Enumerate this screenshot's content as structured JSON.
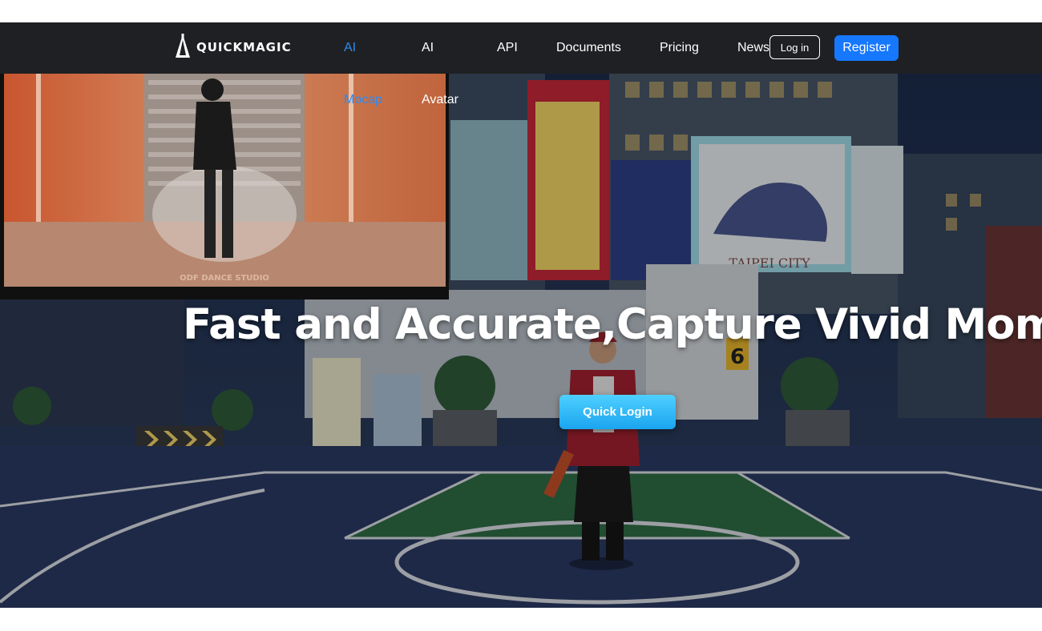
{
  "logo": {
    "text": "QUICKMAGIC",
    "icon": "quickmagic-logo-icon"
  },
  "nav": {
    "items": [
      {
        "label": "AI",
        "active": true
      },
      {
        "label": "AI",
        "active": false
      },
      {
        "label": "API",
        "active": false
      },
      {
        "label": "Documents",
        "active": false
      },
      {
        "label": "Pricing",
        "active": false
      },
      {
        "label": "News",
        "active": false
      }
    ],
    "subitems": [
      {
        "label": "Mocap",
        "active": true
      },
      {
        "label": "Avatar",
        "active": false
      }
    ],
    "login_label": "Log in",
    "register_label": "Register"
  },
  "hero": {
    "headline": "Fast and Accurate,Capture Vivid Moments",
    "cta_label": "Quick Login",
    "video_watermark": "ODF DANCE STUDIO",
    "billboard_sign": "TAIPEI CITY",
    "pillar_number": "6"
  },
  "colors": {
    "accent": "#2b8cf4",
    "register": "#1677ff",
    "navbar": "#1f2023",
    "cta": "#1aa5f0"
  }
}
